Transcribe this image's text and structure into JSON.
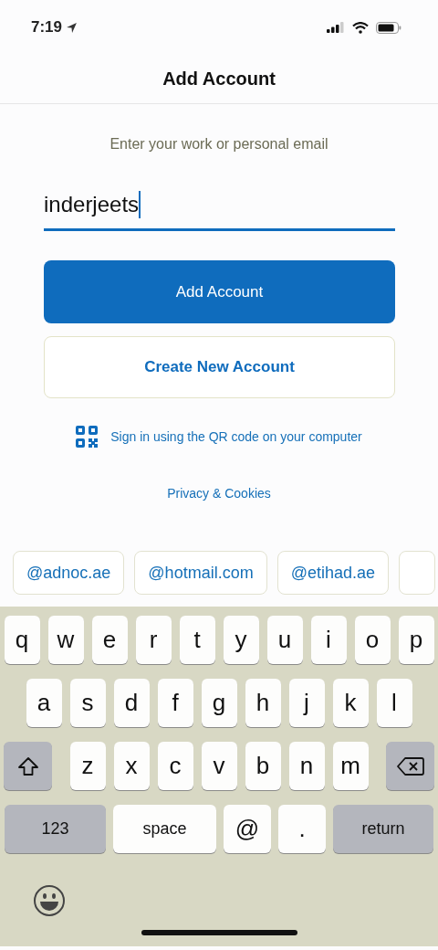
{
  "status_bar": {
    "time": "7:19"
  },
  "header": {
    "title": "Add Account"
  },
  "prompt": "Enter your work or personal email",
  "email_field": {
    "value": "inderjeets",
    "focused": true
  },
  "buttons": [
    {
      "label": "Add Account",
      "kind": "primary"
    },
    {
      "label": "Create New Account",
      "kind": "outline"
    }
  ],
  "qr_link": "Sign in using the QR code on your computer",
  "privacy_link": "Privacy & Cookies",
  "suggestions": [
    {
      "text": "@adnoc.ae"
    },
    {
      "text": "@hotmail.com"
    },
    {
      "text": "@etihad.ae"
    },
    {
      "cut": true
    }
  ],
  "keyboard": {
    "rows": [
      {
        "keys": [
          {
            "kind": "letter",
            "label": "q"
          },
          {
            "kind": "letter",
            "label": "w"
          },
          {
            "kind": "letter",
            "label": "e"
          },
          {
            "kind": "letter",
            "label": "r"
          },
          {
            "kind": "letter",
            "label": "t"
          },
          {
            "kind": "letter",
            "label": "y"
          },
          {
            "kind": "letter",
            "label": "u"
          },
          {
            "kind": "letter",
            "label": "i"
          },
          {
            "kind": "letter",
            "label": "o"
          },
          {
            "kind": "letter",
            "label": "p"
          }
        ]
      },
      {
        "keys": [
          {
            "kind": "letter",
            "label": "a"
          },
          {
            "kind": "letter",
            "label": "s"
          },
          {
            "kind": "letter",
            "label": "d"
          },
          {
            "kind": "letter",
            "label": "f"
          },
          {
            "kind": "letter",
            "label": "g"
          },
          {
            "kind": "letter",
            "label": "h"
          },
          {
            "kind": "letter",
            "label": "j"
          },
          {
            "kind": "letter",
            "label": "k"
          },
          {
            "kind": "letter",
            "label": "l"
          }
        ]
      },
      {
        "keys": [
          {
            "kind": "shift"
          },
          {
            "kind": "letter",
            "label": "z"
          },
          {
            "kind": "letter",
            "label": "x"
          },
          {
            "kind": "letter",
            "label": "c"
          },
          {
            "kind": "letter",
            "label": "v"
          },
          {
            "kind": "letter",
            "label": "b"
          },
          {
            "kind": "letter",
            "label": "n"
          },
          {
            "kind": "letter",
            "label": "m"
          },
          {
            "kind": "delete"
          }
        ]
      },
      {
        "keys": [
          {
            "kind": "mode",
            "label": "123"
          },
          {
            "kind": "space",
            "label": "space"
          },
          {
            "kind": "char",
            "label": "@"
          },
          {
            "kind": "char",
            "label": "."
          },
          {
            "kind": "return",
            "label": "return"
          }
        ]
      }
    ]
  }
}
